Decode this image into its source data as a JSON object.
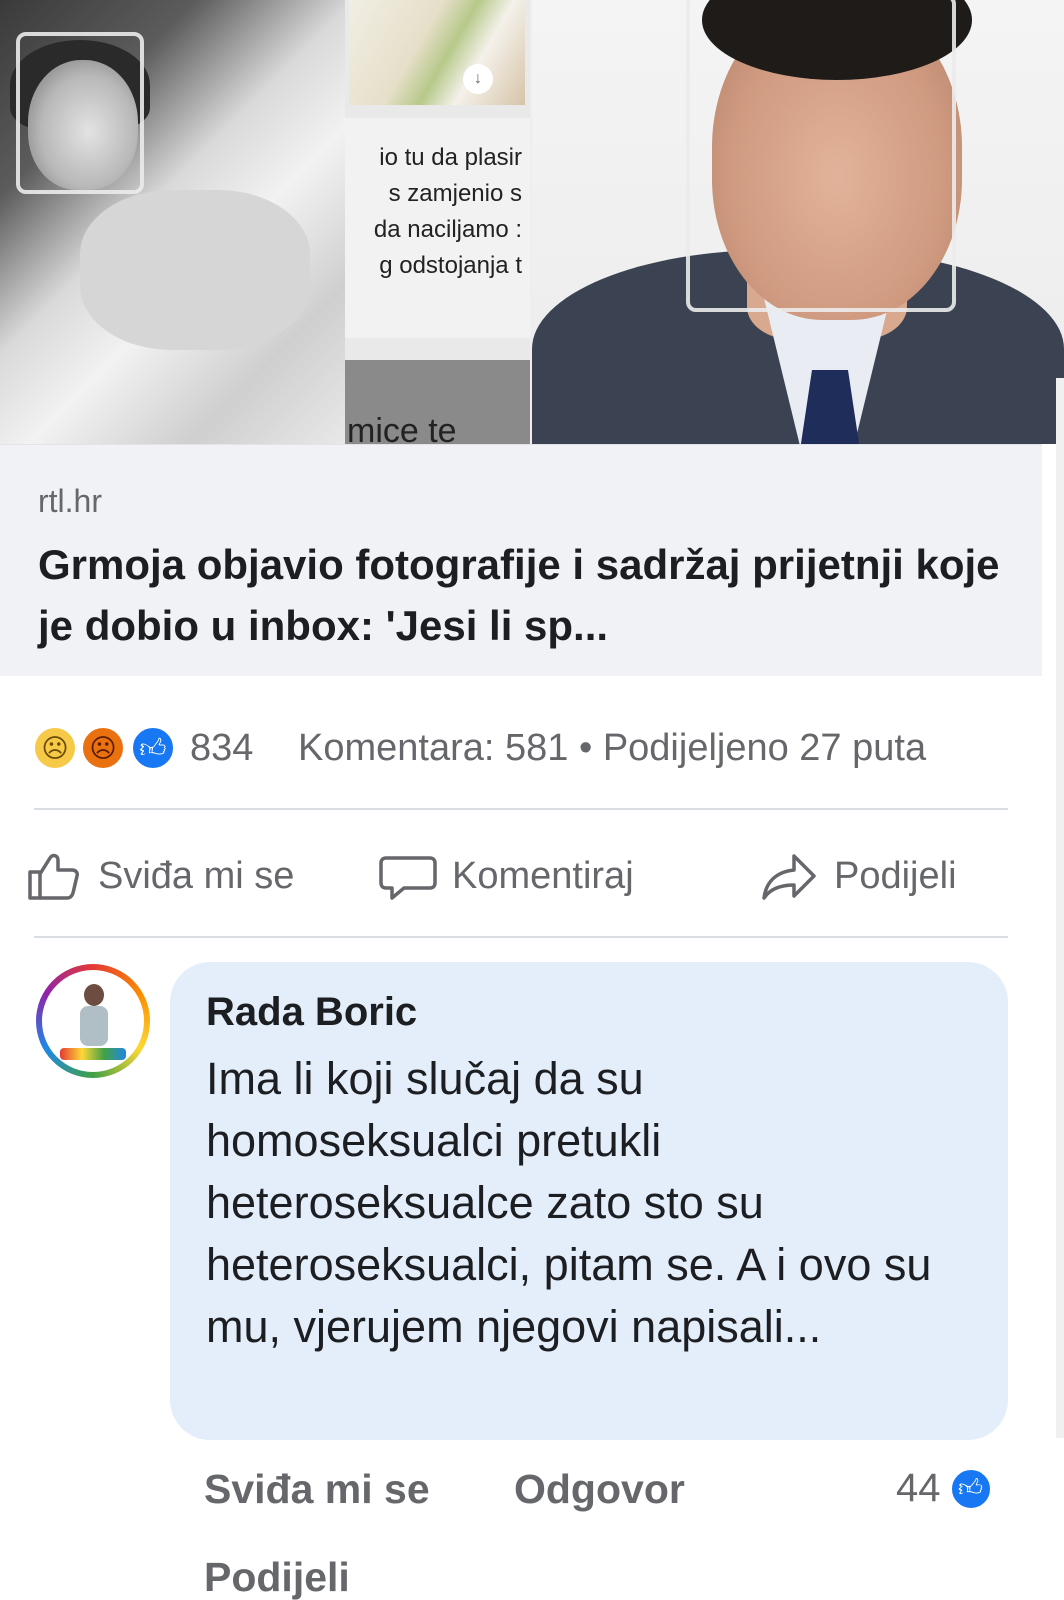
{
  "collage": {
    "snippet_lines": [
      "io tu da plasir",
      "s zamjenio s",
      "da naciljamo :",
      "g odstojanja t"
    ],
    "lower_snippet": "mice te"
  },
  "link": {
    "domain": "rtl.hr",
    "headline": "Grmoja objavio fotografije i sadržaj prijetnji koje je dobio u inbox: 'Jesi li sp..."
  },
  "reactions": {
    "count": "834",
    "meta": "Komentara: 581 • Podijeljeno 27 puta",
    "icons": [
      "sad-face-icon",
      "angry-face-icon",
      "like-thumb-icon"
    ]
  },
  "actions": {
    "like": "Sviđa mi se",
    "comment": "Komentiraj",
    "share": "Podijeli"
  },
  "comment": {
    "author": "Rada Boric",
    "text": "Ima li koji slučaj da su homoseksualci pretukli heteroseksualce zato sto su heteroseksualci, pitam se. A i ovo su mu, vjerujem  njegovi napisali...",
    "like_label": "Sviđa mi se",
    "reply_label": "Odgovor",
    "share_label": "Podijeli",
    "like_count": "44"
  },
  "colors": {
    "brand_blue": "#1877f2",
    "bubble": "#e4eefb",
    "muted_text": "#65676b"
  }
}
